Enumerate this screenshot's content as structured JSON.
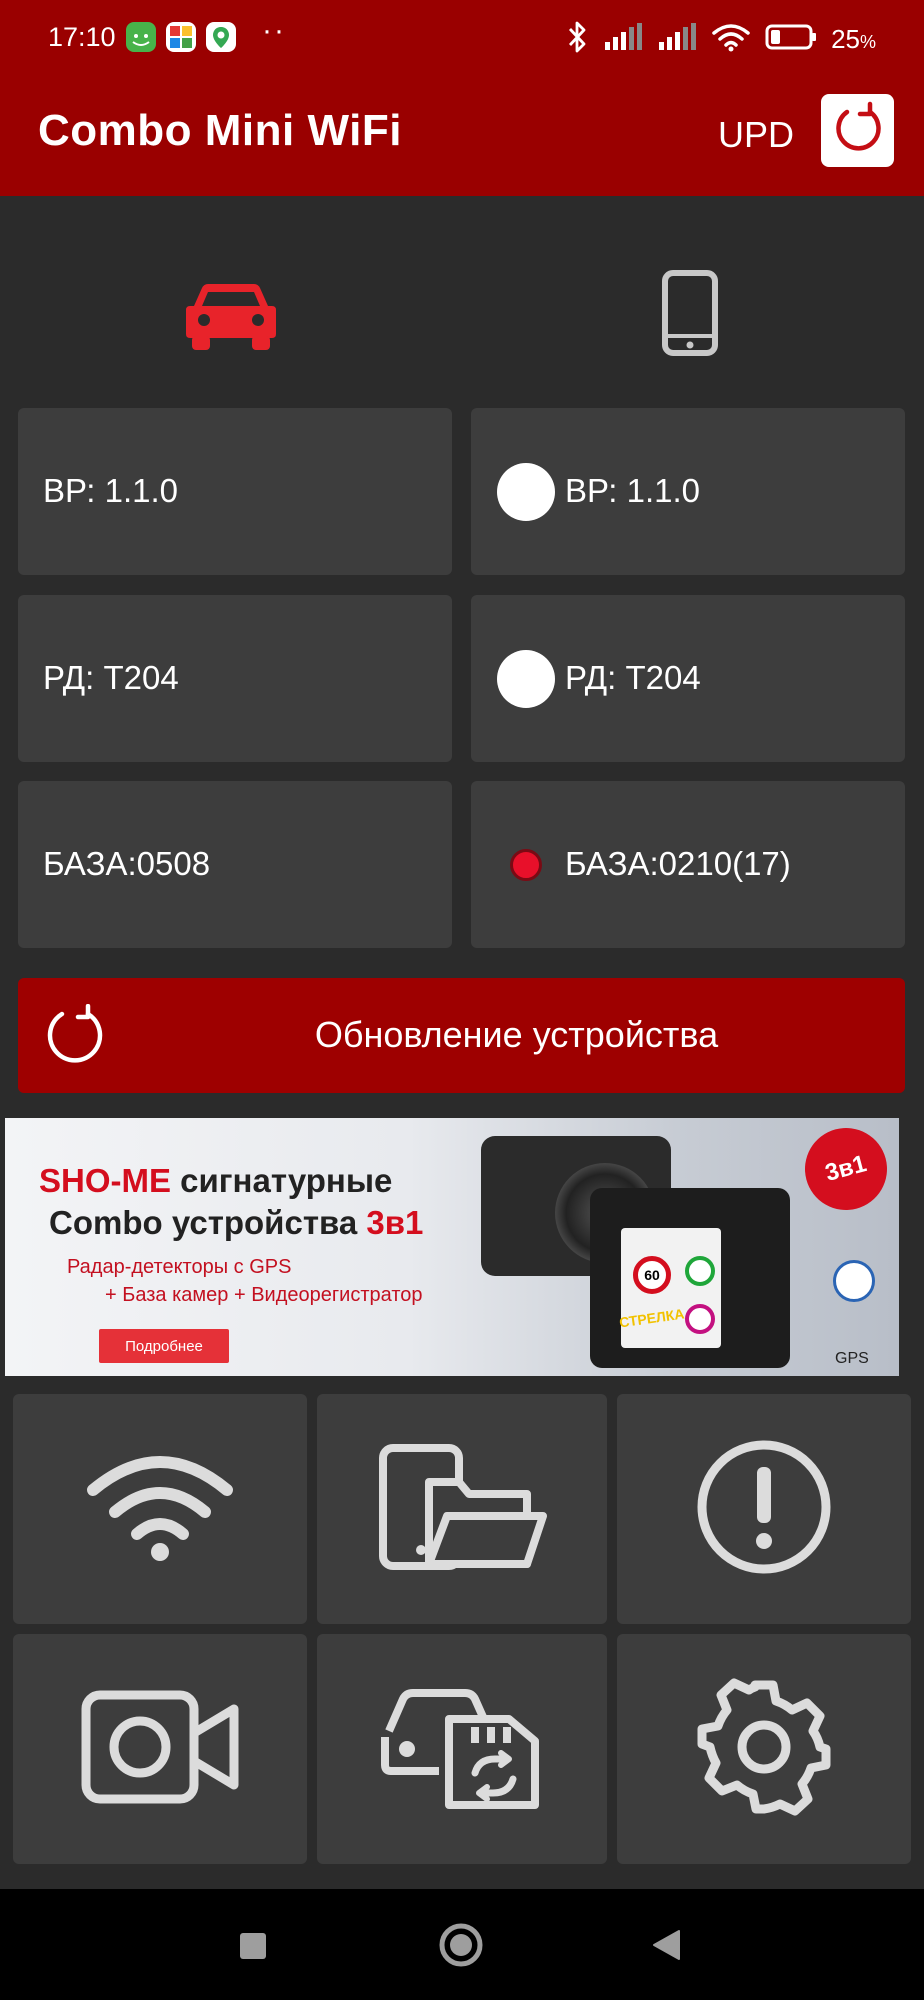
{
  "status_bar": {
    "time": "17:10",
    "app_icons": [
      "android-app-icon",
      "colorful-app-icon",
      "maps-pin-icon"
    ],
    "more": "··",
    "icons": [
      "bluetooth-icon",
      "signal-icon",
      "signal-icon",
      "wifi-icon",
      "battery-icon"
    ],
    "battery": "25",
    "battery_unit": "%",
    "battery_percent": 25
  },
  "app_bar": {
    "title": "Combo Mini WiFi",
    "upd_label": "UPD",
    "upd_icon": "refresh-icon"
  },
  "modes": {
    "car_icon": "car-icon",
    "phone_icon": "smartphone-icon",
    "active": "car",
    "active_color": "#e8232a",
    "inactive_color": "#c8c8c8"
  },
  "device_info": {
    "left": [
      "ВР: 1.1.0",
      "РД: T204",
      "БАЗА:0508"
    ],
    "right": [
      "ВР: 1.1.0",
      "РД: T204",
      "БАЗА:0210(17)"
    ],
    "right_indicators": [
      "white",
      "white",
      "red"
    ]
  },
  "update_button": {
    "label": "Обновление устройства",
    "icon": "refresh-icon"
  },
  "banner": {
    "brand": "SHO-ME",
    "line1_rest": "сигнатурные",
    "line2": "Combo устройства",
    "line2_accent": "3в1",
    "line3": "Радар-детекторы с GPS",
    "line4": "+ База камер + Видеорегистратор",
    "button": "Подробнее",
    "badge": "3в1",
    "gps_label": "GPS"
  },
  "tiles": [
    {
      "name": "wifi-tile",
      "icon": "wifi-icon"
    },
    {
      "name": "file-transfer-tile",
      "icon": "phone-folder-icon"
    },
    {
      "name": "alerts-tile",
      "icon": "exclamation-circle-icon"
    },
    {
      "name": "camera-tile",
      "icon": "video-camera-icon"
    },
    {
      "name": "sd-sync-tile",
      "icon": "car-sdcard-sync-icon"
    },
    {
      "name": "settings-tile",
      "icon": "gear-icon"
    }
  ],
  "nav_bar": {
    "buttons": [
      "recents-square-icon",
      "home-circle-icon",
      "back-triangle-icon"
    ]
  },
  "colors": {
    "brand_red": "#9a0000",
    "card_bg": "#3d3d3d",
    "page_bg": "#2b2b2b",
    "indicator_red": "#e8102a"
  }
}
